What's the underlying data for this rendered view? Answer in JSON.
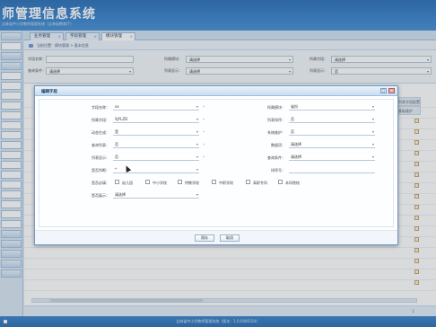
{
  "app": {
    "title": "师管理信息系统",
    "subtitle": "吉林省中小学教师管理系统（吉林省教育厅）"
  },
  "tabs": [
    {
      "label": "业务管理"
    },
    {
      "label": "字段管理"
    },
    {
      "label": "模块管理"
    }
  ],
  "breadcrumb": "当前位置：模块管理 > 基本信息",
  "filter": {
    "row1": [
      {
        "label": "字段名称：",
        "value": ""
      },
      {
        "label": "所属模块：",
        "value": "请选择"
      },
      {
        "label": "所属字段：",
        "value": "请选择"
      }
    ],
    "row2": [
      {
        "label": "查询条件：",
        "value": "请选择"
      },
      {
        "label": "列表显示：",
        "value": "请选择"
      },
      {
        "label": "列表显示：",
        "value": "否"
      }
    ]
  },
  "grid": {
    "col_a": "列表字段配置",
    "col_b": "基础维护"
  },
  "dialog": {
    "title": "编辑字段",
    "fields": {
      "field_name": {
        "label": "字段名称：",
        "value": "xx"
      },
      "module": {
        "label": "所属模块：",
        "value": "省份"
      },
      "field_type": {
        "label": "所属字段：",
        "value": "SJYLZD"
      },
      "list_sort": {
        "label": "列表排序：",
        "value": "否"
      },
      "dynamic": {
        "label": "动态生成：",
        "value": "是"
      },
      "sys_maint": {
        "label": "系统维护：",
        "value": "否"
      },
      "query": {
        "label": "查询列表：",
        "value": "否"
      },
      "data_item": {
        "label": "数据项：",
        "value": "请选择"
      },
      "list_show": {
        "label": "列表显示：",
        "value": "否"
      },
      "query_cond": {
        "label": "查询条件：",
        "value": "请选择"
      },
      "dropdown": {
        "label": "是否判断：",
        "value": "*"
      },
      "sort_no": {
        "label": "排序号：",
        "value": ""
      },
      "school_level": {
        "label": "是否必填：",
        "options": [
          "幼儿园",
          "中小学校",
          "特教学校",
          "中职学校",
          "高职专科",
          "本科院校"
        ]
      },
      "required_sel": {
        "label": "是否展示：",
        "value": "请选择"
      }
    },
    "buttons": {
      "save": "保存",
      "cancel": "取消"
    }
  },
  "footer": "吉林省中小学教师管理系统（版本：1.0.0000314）"
}
